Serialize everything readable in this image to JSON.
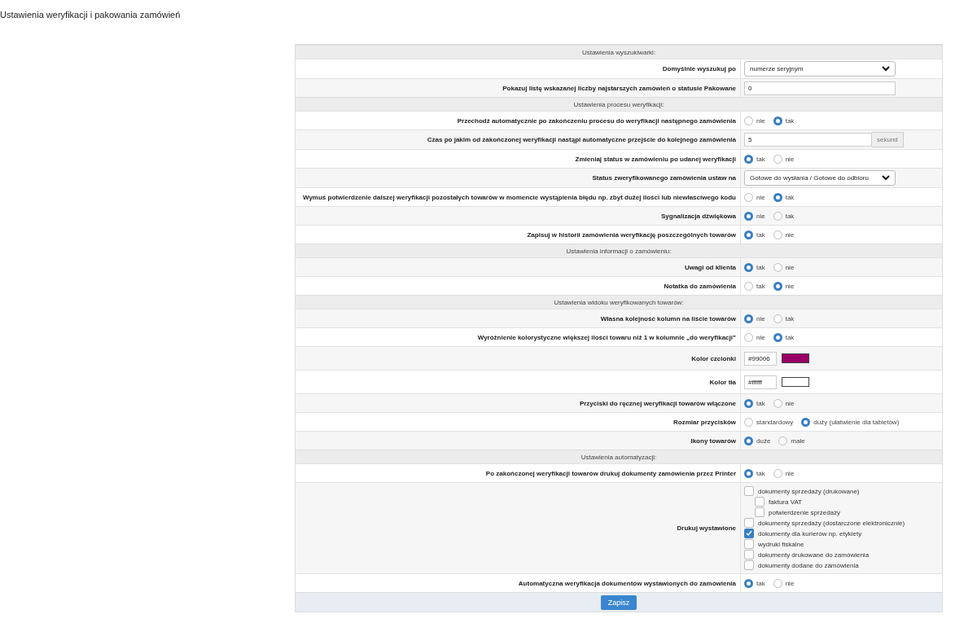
{
  "title": "Ustawienia weryfikacji i pakowania zamówień",
  "sections": [
    {
      "heading": "Ustawienia wyszukiwarki:",
      "rows": [
        {
          "kind": "select",
          "label": "Domyślnie wyszukuj po",
          "value": "numerze seryjnym"
        },
        {
          "kind": "input",
          "label": "Pokazuj listę wskazanej liczby najstarszych zamówień o statusie Pakowane",
          "value": "0"
        }
      ]
    },
    {
      "heading": "Ustawienia procesu weryfikacji:",
      "rows": [
        {
          "kind": "radio",
          "label": "Przechodź automatycznie po zakończeniu procesu do weryfikacji następnego zamówienia",
          "options": [
            {
              "label": "nie",
              "selected": false
            },
            {
              "label": "tak",
              "selected": true
            }
          ]
        },
        {
          "kind": "input",
          "label": "Czas po jakim od zakończonej weryfikacji nastąpi automatyczne przejście do kolejnego zamówienia",
          "value": "5",
          "suffix": "sekund"
        },
        {
          "kind": "radio",
          "label": "Zmieniaj status w zamówieniu po udanej weryfikacji",
          "options": [
            {
              "label": "tak",
              "selected": true
            },
            {
              "label": "nie",
              "selected": false
            }
          ]
        },
        {
          "kind": "select",
          "label": "Status zweryfikowanego zamówienia ustaw na",
          "value": "Gotowe do wysłania / Gotowe do odbioru"
        },
        {
          "kind": "radio",
          "label": "Wymuś potwierdzenie dalszej weryfikacji pozostałych towarów w momencie wystąpienia błędu np. zbyt dużej ilości lub niewłaściwego kodu",
          "options": [
            {
              "label": "nie",
              "selected": false
            },
            {
              "label": "tak",
              "selected": true
            }
          ]
        },
        {
          "kind": "radio",
          "label": "Sygnalizacja dźwiękowa",
          "options": [
            {
              "label": "nie",
              "selected": true
            },
            {
              "label": "tak",
              "selected": false
            }
          ]
        },
        {
          "kind": "radio",
          "label": "Zapisuj w historii zamówienia weryfikację poszczególnych towarów",
          "options": [
            {
              "label": "tak",
              "selected": true
            },
            {
              "label": "nie",
              "selected": false
            }
          ]
        }
      ]
    },
    {
      "heading": "Ustawienia informacji o zamówieniu:",
      "rows": [
        {
          "kind": "radio",
          "label": "Uwagi od klienta",
          "options": [
            {
              "label": "tak",
              "selected": true
            },
            {
              "label": "nie",
              "selected": false
            }
          ]
        },
        {
          "kind": "radio",
          "label": "Notatka do zamówienia",
          "options": [
            {
              "label": "tak",
              "selected": false
            },
            {
              "label": "nie",
              "selected": true
            }
          ]
        }
      ]
    },
    {
      "heading": "Ustawienia widoku weryfikowanych towarów:",
      "rows": [
        {
          "kind": "radio",
          "label": "Własna kolejność kolumn na liście towarów",
          "options": [
            {
              "label": "nie",
              "selected": true
            },
            {
              "label": "tak",
              "selected": false
            }
          ]
        },
        {
          "kind": "radio",
          "label": "Wyróżnienie kolorystyczne większej ilości towaru niż 1 w kolumnie „do weryfikacji”",
          "options": [
            {
              "label": "nie",
              "selected": false
            },
            {
              "label": "tak",
              "selected": true
            }
          ]
        },
        {
          "kind": "color",
          "label": "Kolor czcionki",
          "value": "#99006",
          "color": "#990066"
        },
        {
          "kind": "color",
          "label": "Kolor tła",
          "value": "#ffffff",
          "color": "#ffffff"
        },
        {
          "kind": "radio",
          "label": "Przyciski do ręcznej weryfikacji towarów włączone",
          "options": [
            {
              "label": "tak",
              "selected": true
            },
            {
              "label": "nie",
              "selected": false
            }
          ]
        },
        {
          "kind": "radio",
          "label": "Rozmiar przycisków",
          "options": [
            {
              "label": "standardowy",
              "selected": false
            },
            {
              "label": "duży (ułatwienie dla tabletów)",
              "selected": true
            }
          ]
        },
        {
          "kind": "radio",
          "label": "Ikony towarów",
          "options": [
            {
              "label": "duże",
              "selected": true
            },
            {
              "label": "małe",
              "selected": false
            }
          ]
        }
      ]
    },
    {
      "heading": "Ustawienia automatyzacji:",
      "rows": [
        {
          "kind": "radio",
          "label": "Po zakończonej weryfikacji towarów drukuj dokumenty zamówienia przez Printer",
          "options": [
            {
              "label": "tak",
              "selected": true
            },
            {
              "label": "nie",
              "selected": false
            }
          ]
        },
        {
          "kind": "checks",
          "label": "Drukuj wystawione",
          "items": [
            {
              "label": "dokumenty sprzedaży (drukowane)",
              "checked": false,
              "children": [
                {
                  "label": "faktura VAT",
                  "checked": false
                },
                {
                  "label": "potwierdzenie sprzedaży",
                  "checked": false
                }
              ]
            },
            {
              "label": "dokumenty sprzedaży (dostarczone elektronicznie)",
              "checked": false
            },
            {
              "label": "dokumenty dla kurierów np. etykiety",
              "checked": true
            },
            {
              "label": "wydruki fiskalne",
              "checked": false
            },
            {
              "label": "dokumenty drukowane do zamówienia",
              "checked": false
            },
            {
              "label": "dokumenty dodane do zamówienia",
              "checked": false
            }
          ]
        },
        {
          "kind": "radio",
          "label": "Automatyczna weryfikacja dokumentów wystawionych do zamówienia",
          "options": [
            {
              "label": "tak",
              "selected": true
            },
            {
              "label": "nie",
              "selected": false
            }
          ]
        }
      ]
    }
  ],
  "save_button": "Zapisz"
}
